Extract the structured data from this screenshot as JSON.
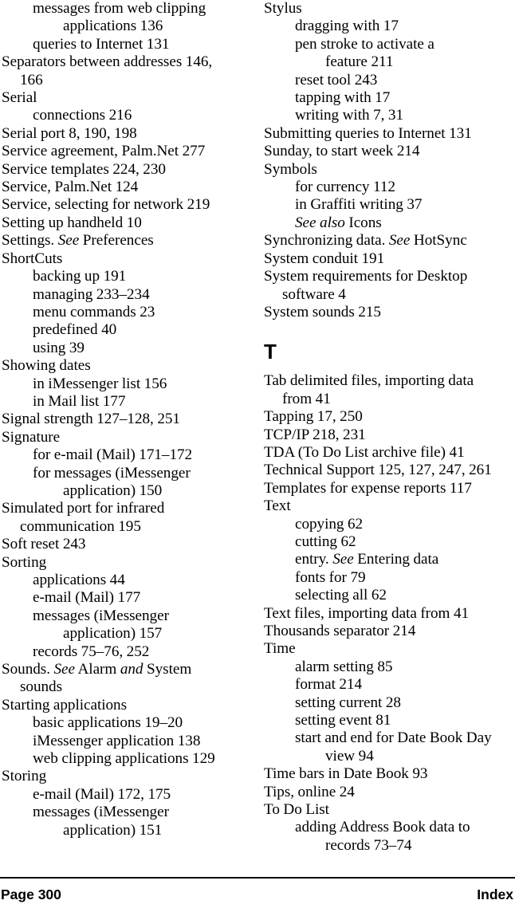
{
  "footer": {
    "page_label": "Page 300",
    "section_label": "Index"
  },
  "columns": [
    {
      "name": "left",
      "blocks": [
        {
          "type": "entry",
          "level": 2,
          "text": "messages from web clipping"
        },
        {
          "type": "entry",
          "level": 3,
          "text": "applications 136"
        },
        {
          "type": "entry",
          "level": 2,
          "text": "queries to Internet 131"
        },
        {
          "type": "entry",
          "level": 0,
          "text": "Separators between addresses 146,"
        },
        {
          "type": "entry",
          "level": 1,
          "text": "166"
        },
        {
          "type": "entry",
          "level": 0,
          "text": "Serial"
        },
        {
          "type": "entry",
          "level": 2,
          "text": "connections 216"
        },
        {
          "type": "entry",
          "level": 0,
          "text": "Serial port 8, 190, 198"
        },
        {
          "type": "entry",
          "level": 0,
          "text": "Service agreement, Palm.Net 277"
        },
        {
          "type": "entry",
          "level": 0,
          "text": "Service templates 224, 230"
        },
        {
          "type": "entry",
          "level": 0,
          "text": "Service, Palm.Net 124"
        },
        {
          "type": "entry",
          "level": 0,
          "text": "Service, selecting for network 219"
        },
        {
          "type": "entry",
          "level": 0,
          "text": "Setting up handheld 10"
        },
        {
          "type": "entry",
          "level": 0,
          "html": "Settings. <em>See</em> Preferences",
          "text": "Settings. See Preferences"
        },
        {
          "type": "entry",
          "level": 0,
          "text": "ShortCuts"
        },
        {
          "type": "entry",
          "level": 2,
          "text": "backing up 191"
        },
        {
          "type": "entry",
          "level": 2,
          "text": "managing 233–234"
        },
        {
          "type": "entry",
          "level": 2,
          "text": "menu commands 23"
        },
        {
          "type": "entry",
          "level": 2,
          "text": "predefined 40"
        },
        {
          "type": "entry",
          "level": 2,
          "text": "using 39"
        },
        {
          "type": "entry",
          "level": 0,
          "text": "Showing dates"
        },
        {
          "type": "entry",
          "level": 2,
          "text": "in iMessenger list 156"
        },
        {
          "type": "entry",
          "level": 2,
          "text": "in Mail list 177"
        },
        {
          "type": "entry",
          "level": 0,
          "text": "Signal strength 127–128, 251"
        },
        {
          "type": "entry",
          "level": 0,
          "text": "Signature"
        },
        {
          "type": "entry",
          "level": 2,
          "text": "for e-mail (Mail) 171–172"
        },
        {
          "type": "entry",
          "level": 2,
          "text": "for messages (iMessenger"
        },
        {
          "type": "entry",
          "level": 3,
          "text": "application) 150"
        },
        {
          "type": "entry",
          "level": 0,
          "text": "Simulated port for infrared"
        },
        {
          "type": "entry",
          "level": 1,
          "text": "communication 195"
        },
        {
          "type": "entry",
          "level": 0,
          "text": "Soft reset 243"
        },
        {
          "type": "entry",
          "level": 0,
          "text": "Sorting"
        },
        {
          "type": "entry",
          "level": 2,
          "text": "applications 44"
        },
        {
          "type": "entry",
          "level": 2,
          "text": "e-mail (Mail) 177"
        },
        {
          "type": "entry",
          "level": 2,
          "text": "messages (iMessenger"
        },
        {
          "type": "entry",
          "level": 3,
          "text": "application) 157"
        },
        {
          "type": "entry",
          "level": 2,
          "text": "records 75–76, 252"
        },
        {
          "type": "entry",
          "level": 0,
          "html": "Sounds. <em>See</em> Alarm <em>and</em> System",
          "text": "Sounds. See Alarm and System"
        },
        {
          "type": "entry",
          "level": 1,
          "text": "sounds"
        },
        {
          "type": "entry",
          "level": 0,
          "text": "Starting applications"
        },
        {
          "type": "entry",
          "level": 2,
          "text": "basic applications 19–20"
        },
        {
          "type": "entry",
          "level": 2,
          "text": "iMessenger application 138"
        },
        {
          "type": "entry",
          "level": 2,
          "text": "web clipping applications 129"
        },
        {
          "type": "entry",
          "level": 0,
          "text": "Storing"
        },
        {
          "type": "entry",
          "level": 2,
          "text": "e-mail (Mail) 172, 175"
        },
        {
          "type": "entry",
          "level": 2,
          "text": "messages (iMessenger"
        },
        {
          "type": "entry",
          "level": 3,
          "text": "application) 151"
        }
      ]
    },
    {
      "name": "right",
      "blocks": [
        {
          "type": "entry",
          "level": 0,
          "text": "Stylus"
        },
        {
          "type": "entry",
          "level": 2,
          "text": "dragging with 17"
        },
        {
          "type": "entry",
          "level": 2,
          "text": "pen stroke to activate a"
        },
        {
          "type": "entry",
          "level": 3,
          "text": "feature 211"
        },
        {
          "type": "entry",
          "level": 2,
          "text": "reset tool 243"
        },
        {
          "type": "entry",
          "level": 2,
          "text": "tapping with 17"
        },
        {
          "type": "entry",
          "level": 2,
          "text": "writing with 7, 31"
        },
        {
          "type": "entry",
          "level": 0,
          "text": "Submitting queries to Internet 131"
        },
        {
          "type": "entry",
          "level": 0,
          "text": "Sunday, to start week 214"
        },
        {
          "type": "entry",
          "level": 0,
          "text": "Symbols"
        },
        {
          "type": "entry",
          "level": 2,
          "text": "for currency 112"
        },
        {
          "type": "entry",
          "level": 2,
          "text": "in Graffiti writing 37"
        },
        {
          "type": "entry",
          "level": 2,
          "html": "<em>See also</em> Icons",
          "text": "See also Icons"
        },
        {
          "type": "entry",
          "level": 0,
          "html": "Synchronizing data. <em>See</em> HotSync",
          "text": "Synchronizing data. See HotSync"
        },
        {
          "type": "entry",
          "level": 0,
          "text": "System conduit 191"
        },
        {
          "type": "entry",
          "level": 0,
          "text": "System requirements for Desktop"
        },
        {
          "type": "entry",
          "level": 1,
          "text": "software 4"
        },
        {
          "type": "entry",
          "level": 0,
          "text": "System sounds 215"
        },
        {
          "type": "heading",
          "text": "T"
        },
        {
          "type": "entry",
          "level": 0,
          "text": "Tab delimited files, importing data"
        },
        {
          "type": "entry",
          "level": 1,
          "text": "from 41"
        },
        {
          "type": "entry",
          "level": 0,
          "text": "Tapping 17, 250"
        },
        {
          "type": "entry",
          "level": 0,
          "text": "TCP/IP 218, 231"
        },
        {
          "type": "entry",
          "level": 0,
          "text": "TDA (To Do List archive file) 41"
        },
        {
          "type": "entry",
          "level": 0,
          "text": "Technical Support 125, 127, 247, 261"
        },
        {
          "type": "entry",
          "level": 0,
          "text": "Templates for expense reports 117"
        },
        {
          "type": "entry",
          "level": 0,
          "text": "Text"
        },
        {
          "type": "entry",
          "level": 2,
          "text": "copying 62"
        },
        {
          "type": "entry",
          "level": 2,
          "text": "cutting 62"
        },
        {
          "type": "entry",
          "level": 2,
          "html": "entry. <em>See</em> Entering data",
          "text": "entry. See Entering data"
        },
        {
          "type": "entry",
          "level": 2,
          "text": "fonts for 79"
        },
        {
          "type": "entry",
          "level": 2,
          "text": "selecting all 62"
        },
        {
          "type": "entry",
          "level": 0,
          "text": "Text files, importing data from 41"
        },
        {
          "type": "entry",
          "level": 0,
          "text": "Thousands separator 214"
        },
        {
          "type": "entry",
          "level": 0,
          "text": "Time"
        },
        {
          "type": "entry",
          "level": 2,
          "text": "alarm setting 85"
        },
        {
          "type": "entry",
          "level": 2,
          "text": "format 214"
        },
        {
          "type": "entry",
          "level": 2,
          "text": "setting current 28"
        },
        {
          "type": "entry",
          "level": 2,
          "text": "setting event 81"
        },
        {
          "type": "entry",
          "level": 2,
          "text": "start and end for Date Book Day"
        },
        {
          "type": "entry",
          "level": 3,
          "text": "view 94"
        },
        {
          "type": "entry",
          "level": 0,
          "text": "Time bars in Date Book 93"
        },
        {
          "type": "entry",
          "level": 0,
          "text": "Tips, online 24"
        },
        {
          "type": "entry",
          "level": 0,
          "text": "To Do List"
        },
        {
          "type": "entry",
          "level": 2,
          "text": "adding Address Book data to"
        },
        {
          "type": "entry",
          "level": 3,
          "text": "records 73–74"
        }
      ]
    }
  ]
}
